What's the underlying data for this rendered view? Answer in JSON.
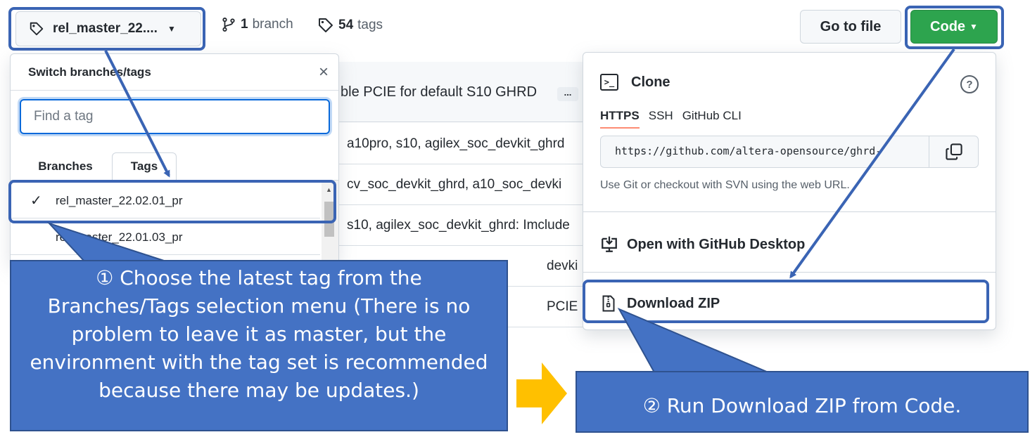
{
  "topbar": {
    "branch_selector_label": "rel_master_22....",
    "branch_count": "1",
    "branch_word": "branch",
    "tag_count": "54",
    "tag_word": "tags",
    "go_to_file": "Go to file",
    "code_button": "Code"
  },
  "files": {
    "commit_message": "ble PCIE for default S10 GHRD",
    "commit_more": "...",
    "rows": [
      "a10pro, s10, agilex_soc_devkit_ghrd",
      "cv_soc_devkit_ghrd, a10_soc_devki",
      "s10, agilex_soc_devkit_ghrd: Imclude",
      "devki",
      "PCIE"
    ]
  },
  "branch_menu": {
    "title": "Switch branches/tags",
    "close": "×",
    "search_placeholder": "Find a tag",
    "tabs": [
      "Branches",
      "Tags"
    ],
    "items": [
      "rel_master_22.02.01_pr",
      "rel_master_22.01.03_pr"
    ]
  },
  "clone_menu": {
    "title": "Clone",
    "help": "?",
    "tabs": [
      "HTTPS",
      "SSH",
      "GitHub CLI"
    ],
    "url": "https://github.com/altera-opensource/ghrd-",
    "help_text": "Use Git or checkout with SVN using the web URL.",
    "open_desktop": "Open with GitHub Desktop",
    "download_zip": "Download ZIP"
  },
  "callouts": {
    "step1": "① Choose the latest tag from the Branches/Tags selection menu (There is no problem to leave it as master, but the environment with the tag set is recommended because there may be updates.)",
    "step2": "② Run Download ZIP from Code."
  },
  "colors": {
    "highlight": "#3a64b4",
    "callout_fill": "#4472c4",
    "code_button": "#2da44e",
    "arrow_orange": "#ffc000"
  }
}
